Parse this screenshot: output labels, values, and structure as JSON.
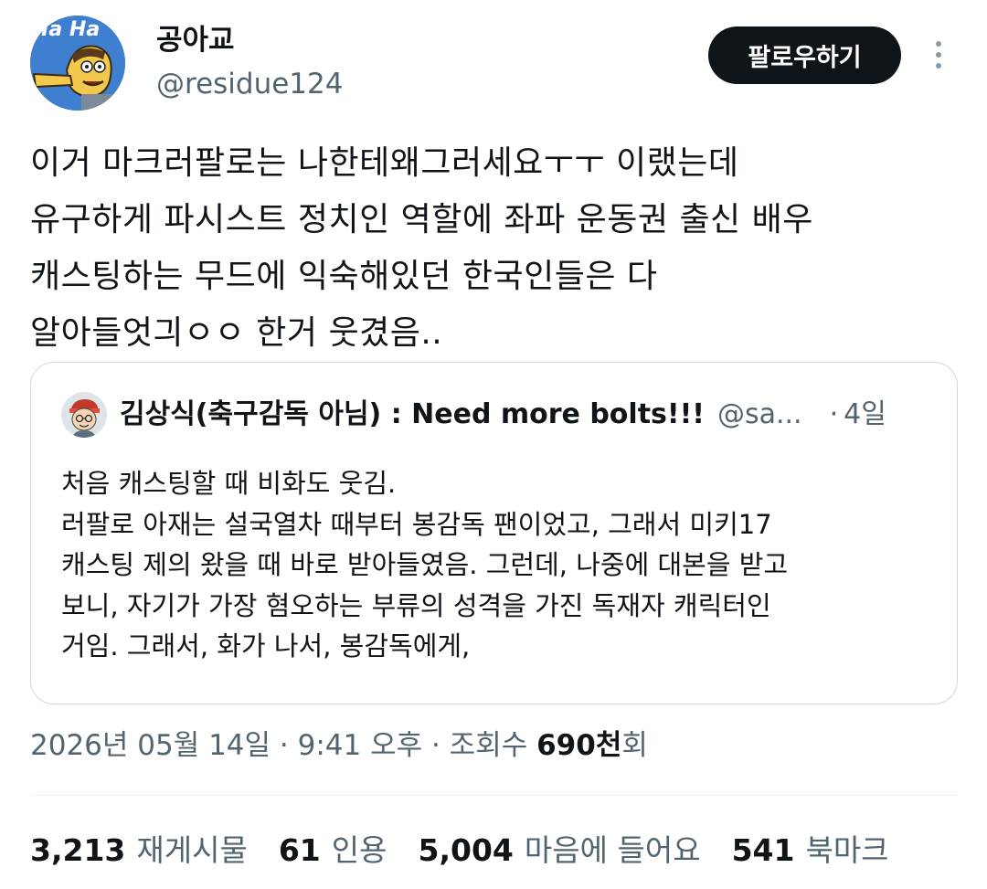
{
  "author": {
    "display_name": "공아교",
    "handle": "@residue124",
    "avatar_icon": "cartoon-avatar-icon",
    "avatar_text": "Ha Ha"
  },
  "follow_button": {
    "label": "팔로우하기"
  },
  "more_icon": "more-vertical-icon",
  "tweet": {
    "lines": [
      "이거 마크러팔로는 나한테왜그러세요ㅜㅜ 이랬는데",
      "유구하게 파시스트 정치인 역할에 좌파 운동권 출신 배우",
      "캐스팅하는 무드에 익숙해있던 한국인들은 다",
      "알아들엇긔ㅇㅇ 한거 웃겼음.."
    ]
  },
  "quote": {
    "display_name": "김상식(축구감독 아님) : Need more bolts!!!",
    "handle": "@sa...",
    "separator": "·",
    "time": "4일",
    "lines": [
      "처음 캐스팅할 때 비화도 웃김.",
      "러팔로 아재는 설국열차 때부터 봉감독 팬이었고, 그래서 미키17",
      "캐스팅 제의 왔을 때 바로 받아들였음. 그런데, 나중에 대본을 받고",
      "보니, 자기가 가장 혐오하는 부류의 성격을 가진 독재자 캐릭터인",
      "거임. 그래서, 화가 나서, 봉감독에게,"
    ]
  },
  "meta": {
    "prefix": "2026년 05월 14일 · 9:41 오후 · 조회수 ",
    "views": "690천",
    "suffix": "회"
  },
  "stats": [
    {
      "value": "3,213",
      "label": "재게시물"
    },
    {
      "value": "61",
      "label": "인용"
    },
    {
      "value": "5,004",
      "label": "마음에 들어요"
    },
    {
      "value": "541",
      "label": "북마크"
    }
  ],
  "colors": {
    "text": "#0f1419",
    "secondary": "#536471",
    "border": "#cfd9de",
    "button_bg": "#0f1419"
  }
}
